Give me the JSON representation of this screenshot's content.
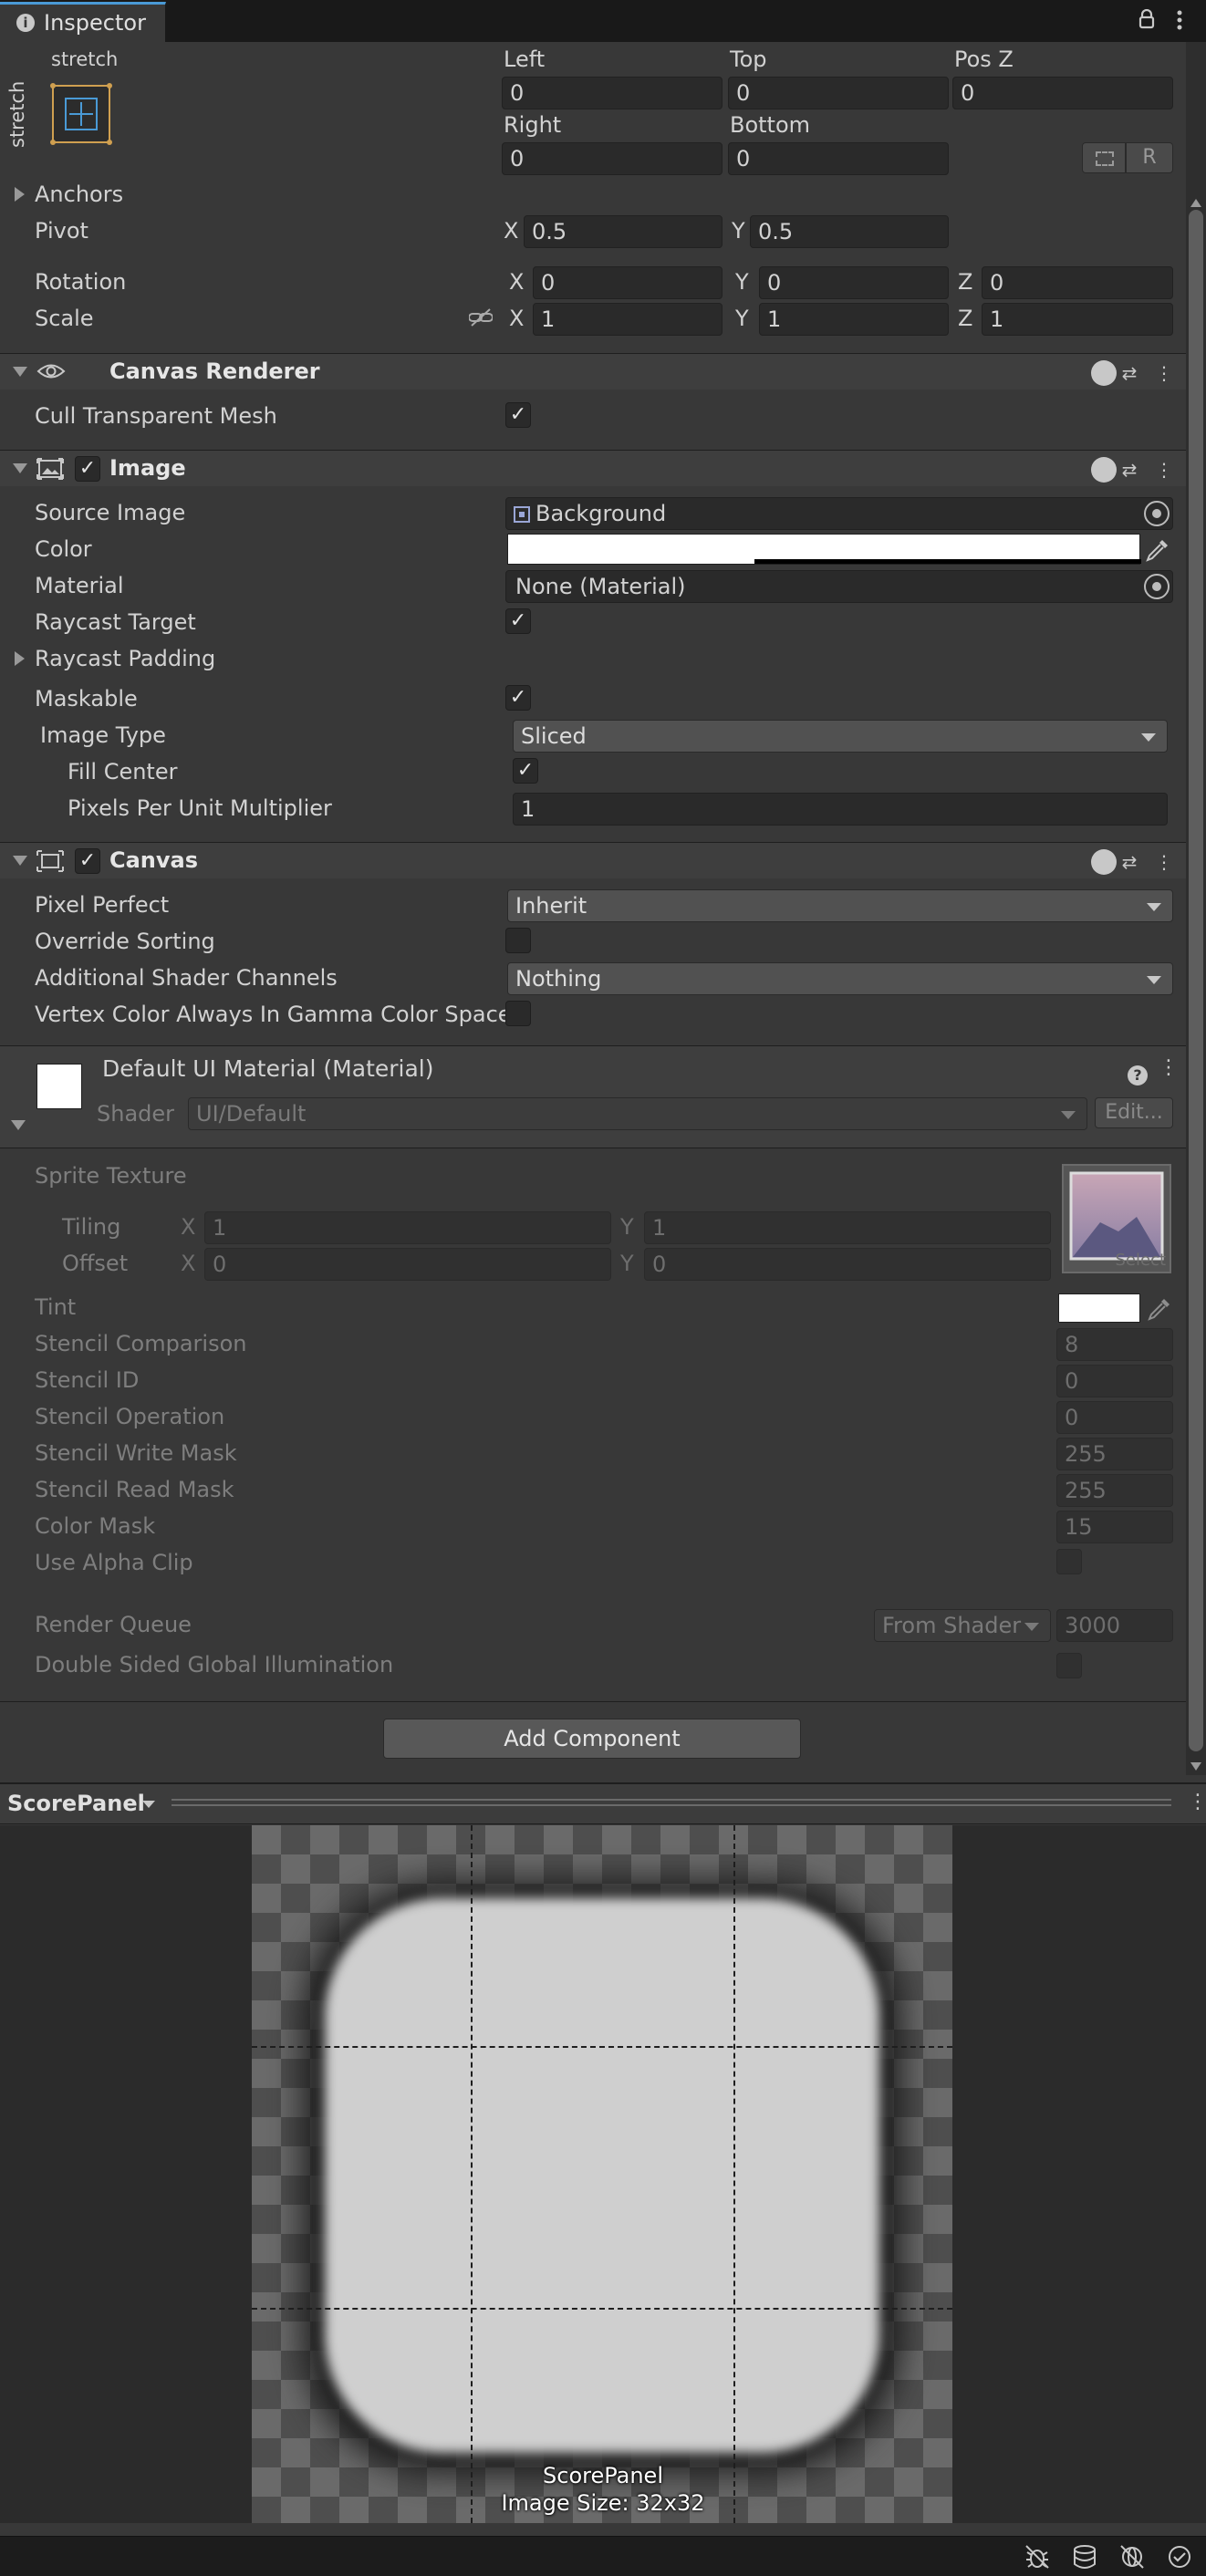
{
  "tab": {
    "title": "Inspector",
    "info_icon": "info-icon",
    "lock_icon": "lock-icon",
    "menu_icon": "kebab-menu-icon"
  },
  "rect": {
    "anchor_top": "stretch",
    "anchor_side": "stretch",
    "left_label": "Left",
    "left_value": "0",
    "top_label": "Top",
    "top_value": "0",
    "posz_label": "Pos Z",
    "posz_value": "0",
    "right_label": "Right",
    "right_value": "0",
    "bottom_label": "Bottom",
    "bottom_value": "0",
    "r_button": "R",
    "anchors_label": "Anchors",
    "pivot_label": "Pivot",
    "pivot_x": "0.5",
    "pivot_y": "0.5",
    "rotation_label": "Rotation",
    "rot_x": "0",
    "rot_y": "0",
    "rot_z": "0",
    "scale_label": "Scale",
    "scale_x": "1",
    "scale_y": "1",
    "scale_z": "1",
    "x": "X",
    "y": "Y",
    "z": "Z"
  },
  "canvas_renderer": {
    "title": "Canvas Renderer",
    "cull_label": "Cull Transparent Mesh",
    "cull_checked": "✓"
  },
  "image": {
    "title": "Image",
    "enabled": "✓",
    "source_label": "Source Image",
    "source_value": "Background",
    "color_label": "Color",
    "material_label": "Material",
    "material_value": "None (Material)",
    "raycast_label": "Raycast Target",
    "raycast_checked": "✓",
    "raycast_padding_label": "Raycast Padding",
    "maskable_label": "Maskable",
    "maskable_checked": "✓",
    "image_type_label": "Image Type",
    "image_type_value": "Sliced",
    "fill_center_label": "Fill Center",
    "fill_center_checked": "✓",
    "ppu_label": "Pixels Per Unit Multiplier",
    "ppu_value": "1"
  },
  "canvas": {
    "title": "Canvas",
    "enabled": "✓",
    "pixel_perfect_label": "Pixel Perfect",
    "pixel_perfect_value": "Inherit",
    "override_sorting_label": "Override Sorting",
    "shader_channels_label": "Additional Shader Channels",
    "shader_channels_value": "Nothing",
    "vertex_color_label": "Vertex Color Always In Gamma Color Space"
  },
  "material": {
    "title": "Default UI Material (Material)",
    "shader_label": "Shader",
    "shader_value": "UI/Default",
    "edit_button": "Edit...",
    "sprite_texture_label": "Sprite Texture",
    "tiling_label": "Tiling",
    "tiling_x": "1",
    "tiling_y": "1",
    "offset_label": "Offset",
    "offset_x": "0",
    "offset_y": "0",
    "select_label": "Select",
    "tint_label": "Tint",
    "props": [
      {
        "label": "Stencil Comparison",
        "value": "8"
      },
      {
        "label": "Stencil ID",
        "value": "0"
      },
      {
        "label": "Stencil Operation",
        "value": "0"
      },
      {
        "label": "Stencil Write Mask",
        "value": "255"
      },
      {
        "label": "Stencil Read Mask",
        "value": "255"
      },
      {
        "label": "Color Mask",
        "value": "15"
      }
    ],
    "alpha_clip_label": "Use Alpha Clip",
    "render_queue_label": "Render Queue",
    "render_queue_mode": "From Shader",
    "render_queue_value": "3000",
    "dsgi_label": "Double Sided Global Illumination"
  },
  "add_component": "Add Component",
  "preview": {
    "title": "ScorePanel",
    "name": "ScorePanel",
    "size": "Image Size: 32x32"
  },
  "colors": {
    "bg": "#383838",
    "header": "#3e3e3e",
    "field": "#2a2a2a",
    "accent": "#4a9ad6"
  }
}
